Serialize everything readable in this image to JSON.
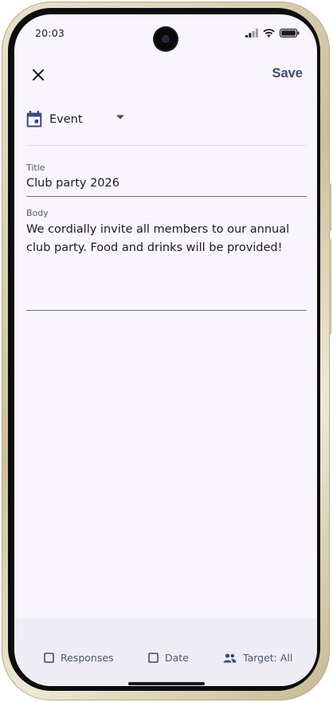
{
  "status_bar": {
    "time": "20:03",
    "icons": [
      "signal-icon",
      "wifi-icon",
      "battery-icon"
    ]
  },
  "top_bar": {
    "close_icon": "close-icon",
    "save_label": "Save"
  },
  "post_type": {
    "icon": "calendar-icon",
    "selected": "Event"
  },
  "title_field": {
    "label": "Title",
    "value": "Club party 2026"
  },
  "body_field": {
    "label": "Body",
    "value": "We cordially invite all members to our annual club party. Food and drinks will be provided!"
  },
  "bottom_bar": {
    "responses_label": "Responses",
    "date_label": "Date",
    "target_label": "Target: All"
  },
  "colors": {
    "accent": "#3b4a7a",
    "background": "#f9f5fd",
    "bottom_bar": "#eeedf3"
  }
}
